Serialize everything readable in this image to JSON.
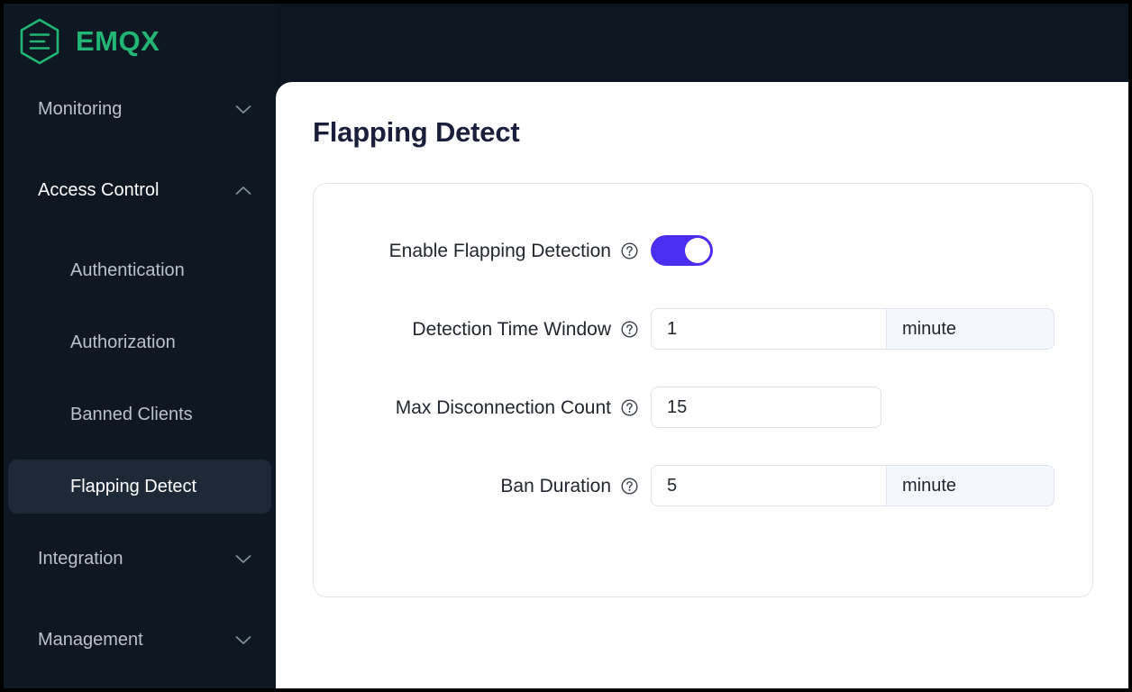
{
  "brand": {
    "name": "EMQX",
    "logo_icon": "emqx-hexagon-logo",
    "accent_color": "#22b573"
  },
  "sidebar": {
    "background_color": "#0d1822",
    "groups": [
      {
        "label": "Monitoring",
        "icon": "chevron-down-icon",
        "expanded": false
      },
      {
        "label": "Access Control",
        "icon": "chevron-up-icon",
        "expanded": true
      },
      {
        "label": "Integration",
        "icon": "chevron-down-icon",
        "expanded": false
      },
      {
        "label": "Management",
        "icon": "chevron-down-icon",
        "expanded": false
      }
    ],
    "access_control_items": [
      {
        "label": "Authentication",
        "active": false
      },
      {
        "label": "Authorization",
        "active": false
      },
      {
        "label": "Banned Clients",
        "active": false
      },
      {
        "label": "Flapping Detect",
        "active": true
      }
    ]
  },
  "main": {
    "title": "Flapping Detect",
    "title_color": "#1b1f3b",
    "form": {
      "enable": {
        "label": "Enable Flapping Detection",
        "help_icon": "question-circle-icon",
        "toggle_on": true,
        "toggle_color": "#4b2ff0"
      },
      "detection_window": {
        "label": "Detection Time Window",
        "help_icon": "question-circle-icon",
        "value": "1",
        "unit": "minute"
      },
      "max_disconnection": {
        "label": "Max Disconnection Count",
        "help_icon": "question-circle-icon",
        "value": "15"
      },
      "ban_duration": {
        "label": "Ban Duration",
        "help_icon": "question-circle-icon",
        "value": "5",
        "unit": "minute"
      }
    }
  }
}
